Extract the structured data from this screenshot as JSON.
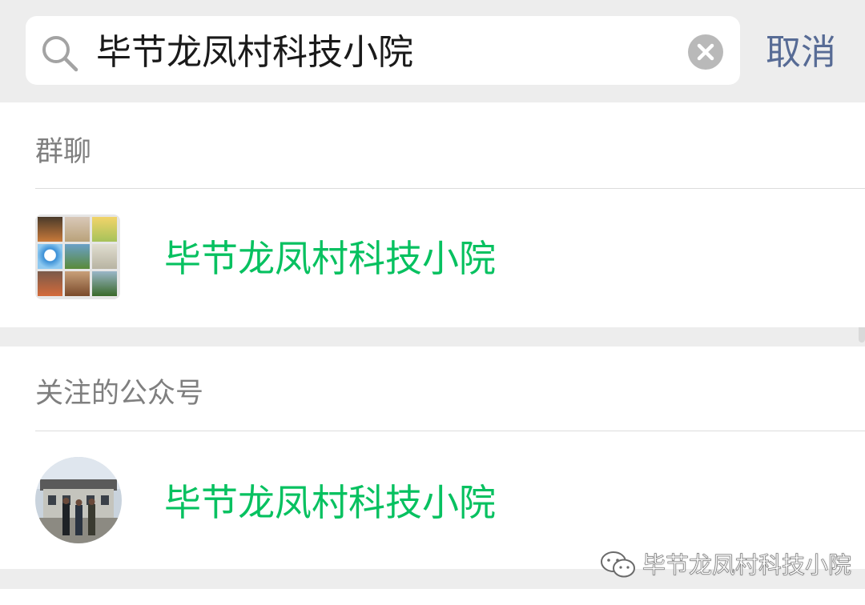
{
  "search": {
    "query": "毕节龙凤村科技小院",
    "cancel_label": "取消"
  },
  "sections": [
    {
      "header": "群聊",
      "results": [
        {
          "title": "毕节龙凤村科技小院"
        }
      ]
    },
    {
      "header": "关注的公众号",
      "results": [
        {
          "title": "毕节龙凤村科技小院"
        }
      ]
    }
  ],
  "watermark": {
    "text": "毕节龙凤村科技小院"
  },
  "colors": {
    "background": "#ededed",
    "highlight_green": "#07c160",
    "cancel_blue": "#576b95",
    "section_header_gray": "#7f7f7f"
  },
  "icons": [
    "search-icon",
    "clear-icon",
    "wechat-logo-icon"
  ]
}
